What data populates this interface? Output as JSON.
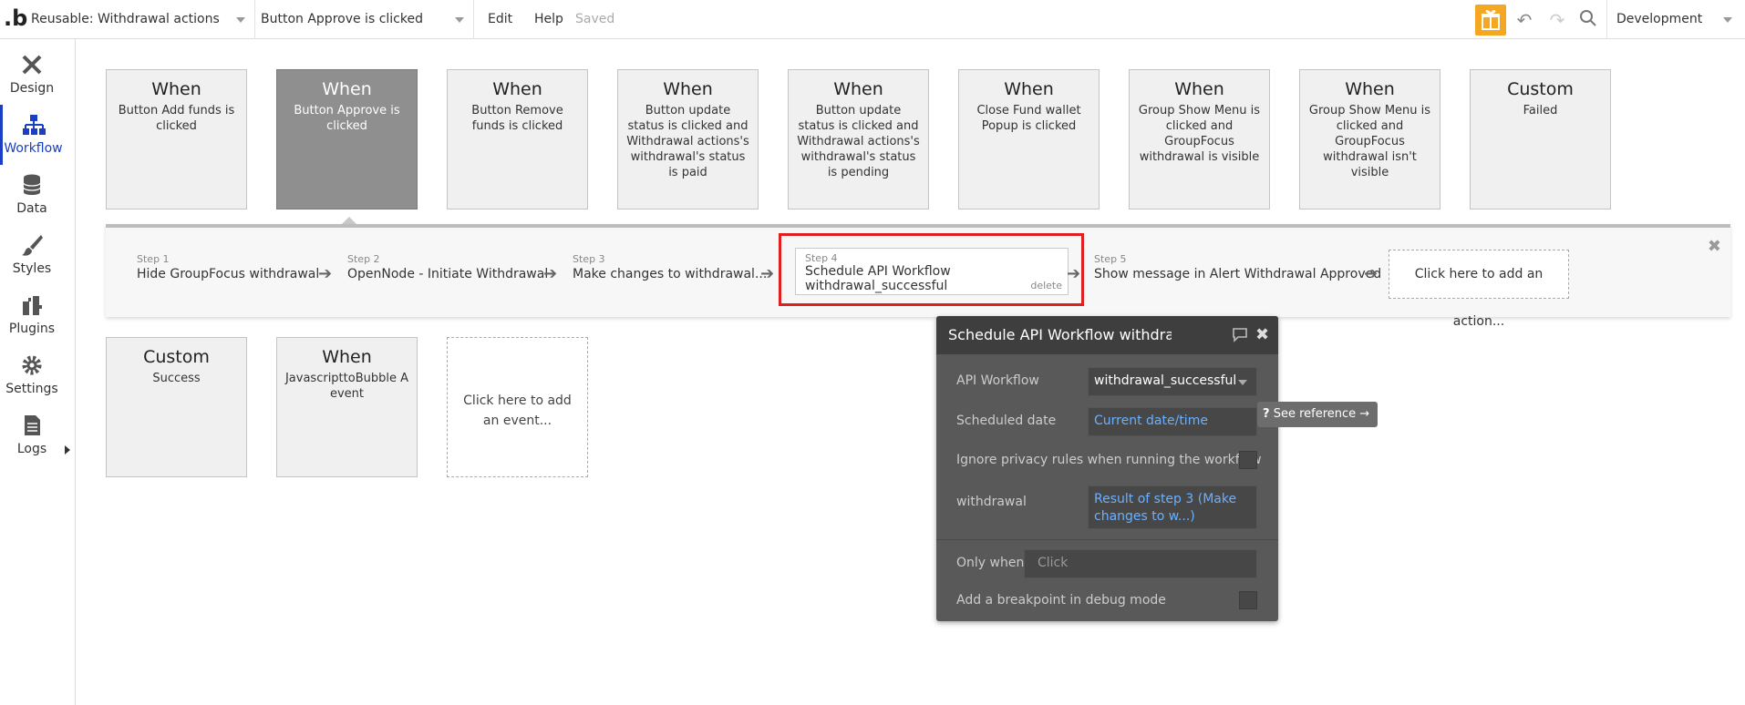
{
  "topbar": {
    "page_selector": "Reusable: Withdrawal actions",
    "event_selector": "Button Approve is clicked",
    "menu": [
      "Edit",
      "Help"
    ],
    "status": "Saved",
    "environment": "Development",
    "accent": "#f5a623"
  },
  "sidebar": {
    "items": [
      {
        "label": "Design",
        "icon": "design-icon"
      },
      {
        "label": "Workflow",
        "icon": "workflow-icon",
        "active": true
      },
      {
        "label": "Data",
        "icon": "database-icon"
      },
      {
        "label": "Styles",
        "icon": "brush-icon"
      },
      {
        "label": "Plugins",
        "icon": "plugin-icon"
      },
      {
        "label": "Settings",
        "icon": "gear-icon"
      },
      {
        "label": "Logs",
        "icon": "document-icon"
      }
    ]
  },
  "events": [
    {
      "kind": "When",
      "desc": "Button Add funds is clicked"
    },
    {
      "kind": "When",
      "desc": "Button Approve is clicked",
      "selected": true
    },
    {
      "kind": "When",
      "desc": "Button Remove funds is clicked"
    },
    {
      "kind": "When",
      "desc": "Button update status is clicked and Withdrawal actions's withdrawal's status is paid"
    },
    {
      "kind": "When",
      "desc": "Button update status is clicked and Withdrawal actions's withdrawal's status is pending"
    },
    {
      "kind": "When",
      "desc": "Close Fund wallet Popup is clicked"
    },
    {
      "kind": "When",
      "desc": "Group Show Menu is clicked and GroupFocus withdrawal is visible"
    },
    {
      "kind": "When",
      "desc": "Group Show Menu is clicked and GroupFocus withdrawal isn't visible"
    },
    {
      "kind": "Custom",
      "desc": "Failed"
    },
    {
      "kind": "Custom",
      "desc": "Success"
    },
    {
      "kind": "When",
      "desc": "JavascripttoBubble A event"
    }
  ],
  "add_event_label": "Click here to add an event...",
  "steps": [
    {
      "num": "Step 1",
      "label": "Hide GroupFocus withdrawal"
    },
    {
      "num": "Step 2",
      "label": "OpenNode - Initiate Withdrawal"
    },
    {
      "num": "Step 3",
      "label": "Make changes to withdrawal..."
    },
    {
      "num": "Step 4",
      "label": "Schedule API Workflow withdrawal_successful",
      "delete": "delete"
    },
    {
      "num": "Step 5",
      "label": "Show message in Alert Withdrawal Approved"
    }
  ],
  "add_action_label": "Click here to add an action...",
  "panel": {
    "title": "Schedule API Workflow withdrawal_successful",
    "api_workflow_label": "API Workflow",
    "api_workflow_value": "withdrawal_successful",
    "scheduled_date_label": "Scheduled date",
    "scheduled_date_value": "Current date/time",
    "ignore_privacy_label": "Ignore privacy rules when running the workflow",
    "withdrawal_label": "withdrawal",
    "withdrawal_value": "Result of step 3 (Make changes to w...)",
    "only_when_label": "Only when",
    "only_when_placeholder": "Click",
    "breakpoint_label": "Add a breakpoint in debug mode"
  },
  "see_reference": "See reference →"
}
